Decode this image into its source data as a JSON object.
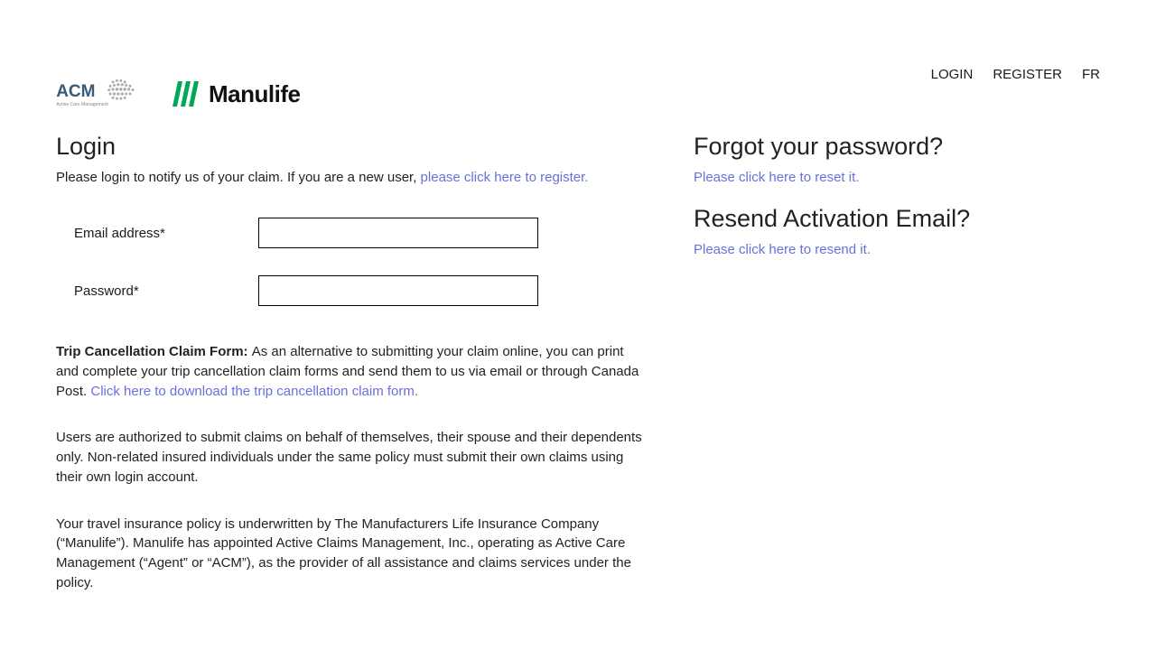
{
  "nav": {
    "login": "LOGIN",
    "register": "REGISTER",
    "lang": "FR"
  },
  "logos": {
    "acm_text": "ACM",
    "acm_sub": "Active Care Management",
    "manulife": "Manulife"
  },
  "login": {
    "heading": "Login",
    "intro_prefix": "Please login to notify us of your claim. If you are a new user, ",
    "intro_link": "please click here to register.",
    "email_label": "Email address*",
    "email_value": "",
    "password_label": "Password*",
    "password_value": ""
  },
  "trip": {
    "bold": "Trip Cancellation Claim Form: ",
    "text": "As an alternative to submitting your claim online, you can print and complete your trip cancellation claim forms and send them to us via email or through Canada Post. ",
    "link": "Click here to download the trip cancellation claim form."
  },
  "auth_text": "Users are authorized to submit claims on behalf of themselves, their spouse and their dependents only. Non-related insured individuals under the same policy must submit their own claims using their own login account.",
  "policy_text": "Your travel insurance policy is underwritten by The Manufacturers Life Insurance Company (“Manulife”). Manulife has appointed Active Claims Management, Inc., operating as Active Care Management (“Agent” or “ACM”), as the provider of all assistance and claims services under the policy.",
  "forgot": {
    "heading": "Forgot your password?",
    "link": "Please click here to reset it."
  },
  "resend": {
    "heading": "Resend Activation Email?",
    "link": "Please click here to resend it."
  }
}
